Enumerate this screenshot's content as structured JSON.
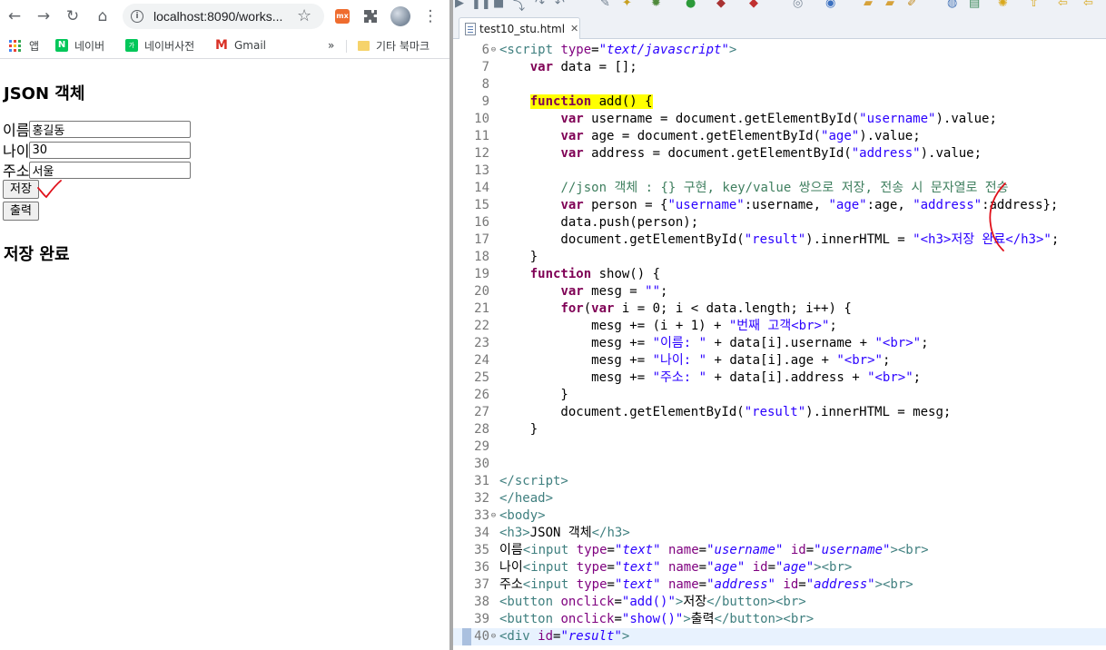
{
  "browser": {
    "url": "localhost:8090/works...",
    "bookmarks": [
      {
        "label": "앱",
        "icon": "apps-grid-icon"
      },
      {
        "label": "네이버",
        "icon": "naver-icon"
      },
      {
        "label": "네이버사전",
        "icon": "naver-dictionary-icon"
      },
      {
        "label": "Gmail",
        "icon": "gmail-icon"
      },
      {
        "label": "기타 북마크",
        "icon": "folder-icon"
      }
    ],
    "overflow_label": "»",
    "page": {
      "heading": "JSON 객체",
      "fields": [
        {
          "label": "이름",
          "value": "홍길동"
        },
        {
          "label": "나이",
          "value": "30"
        },
        {
          "label": "주소",
          "value": "서울"
        }
      ],
      "save_button": "저장",
      "show_button": "출력",
      "result": "저장 완료"
    }
  },
  "editor": {
    "tab_title": "test10_stu.html",
    "lines": [
      {
        "n": "6",
        "fold": true,
        "html": "<span class='tag'>&lt;script</span> <span class='attr'>type</span>=<span class='aval'>\"text/javascript\"</span><span class='tag'>&gt;</span>"
      },
      {
        "n": "7",
        "html": "    <span class='kw'>var</span> data = [];"
      },
      {
        "n": "8",
        "html": ""
      },
      {
        "n": "9",
        "html": "    <span class='hl'><span class='kw'>function</span> add() {</span>"
      },
      {
        "n": "10",
        "html": "        <span class='kw'>var</span> username = document.getElementById(<span class='str'>\"username\"</span>).value;"
      },
      {
        "n": "11",
        "html": "        <span class='kw'>var</span> age = document.getElementById(<span class='str'>\"age\"</span>).value;"
      },
      {
        "n": "12",
        "html": "        <span class='kw'>var</span> address = document.getElementById(<span class='str'>\"address\"</span>).value;"
      },
      {
        "n": "13",
        "html": ""
      },
      {
        "n": "14",
        "html": "        <span class='cmt'>//json 객체 : {} 구현, key/value 쌍으로 저장, 전송 시 문자열로 전송</span>"
      },
      {
        "n": "15",
        "html": "        <span class='kw'>var</span> person = {<span class='str'>\"username\"</span>:username, <span class='str'>\"age\"</span>:age, <span class='str'>\"address\"</span>:address};"
      },
      {
        "n": "16",
        "html": "        data.push(person);"
      },
      {
        "n": "17",
        "html": "        document.getElementById(<span class='str'>\"result\"</span>).innerHTML = <span class='str'>\"&lt;h3&gt;저장 완료&lt;/h3&gt;\"</span>;"
      },
      {
        "n": "18",
        "html": "    }"
      },
      {
        "n": "19",
        "html": "    <span class='kw'>function</span> show() {"
      },
      {
        "n": "20",
        "html": "        <span class='kw'>var</span> mesg = <span class='str'>\"\"</span>;"
      },
      {
        "n": "21",
        "html": "        <span class='kw'>for</span>(<span class='kw'>var</span> i = 0; i &lt; data.length; i++) {"
      },
      {
        "n": "22",
        "html": "            mesg += (i + 1) + <span class='str'>\"번째 고객&lt;br&gt;\"</span>;"
      },
      {
        "n": "23",
        "html": "            mesg += <span class='str'>\"이름: \"</span> + data[i].username + <span class='str'>\"&lt;br&gt;\"</span>;"
      },
      {
        "n": "24",
        "html": "            mesg += <span class='str'>\"나이: \"</span> + data[i].age + <span class='str'>\"&lt;br&gt;\"</span>;"
      },
      {
        "n": "25",
        "html": "            mesg += <span class='str'>\"주소: \"</span> + data[i].address + <span class='str'>\"&lt;br&gt;\"</span>;"
      },
      {
        "n": "26",
        "html": "        }"
      },
      {
        "n": "27",
        "html": "        document.getElementById(<span class='str'>\"result\"</span>).innerHTML = mesg;"
      },
      {
        "n": "28",
        "html": "    }"
      },
      {
        "n": "29",
        "html": ""
      },
      {
        "n": "30",
        "html": ""
      },
      {
        "n": "31",
        "html": "<span class='tag'>&lt;/script&gt;</span>"
      },
      {
        "n": "32",
        "html": "<span class='tag'>&lt;/head&gt;</span>"
      },
      {
        "n": "33",
        "fold": true,
        "html": "<span class='tag'>&lt;body&gt;</span>"
      },
      {
        "n": "34",
        "html": "<span class='tag'>&lt;h3&gt;</span>JSON 객체<span class='tag'>&lt;/h3&gt;</span>"
      },
      {
        "n": "35",
        "html": "이름<span class='tag'>&lt;input</span> <span class='attr'>type</span>=<span class='aval'>\"text\"</span> <span class='attr'>name</span>=<span class='aval'>\"username\"</span> <span class='attr'>id</span>=<span class='aval'>\"username\"</span><span class='tag'>&gt;&lt;br&gt;</span>"
      },
      {
        "n": "36",
        "html": "나이<span class='tag'>&lt;input</span> <span class='attr'>type</span>=<span class='aval'>\"text\"</span> <span class='attr'>name</span>=<span class='aval'>\"age\"</span> <span class='attr'>id</span>=<span class='aval'>\"age\"</span><span class='tag'>&gt;&lt;br&gt;</span>"
      },
      {
        "n": "37",
        "html": "주소<span class='tag'>&lt;input</span> <span class='attr'>type</span>=<span class='aval'>\"text\"</span> <span class='attr'>name</span>=<span class='aval'>\"address\"</span> <span class='attr'>id</span>=<span class='aval'>\"address\"</span><span class='tag'>&gt;&lt;br&gt;</span>"
      },
      {
        "n": "38",
        "html": "<span class='tag'>&lt;button</span> <span class='attr'>onclick</span>=<span class='str'>\"add()\"</span><span class='tag'>&gt;</span>저장<span class='tag'>&lt;/button&gt;&lt;br&gt;</span>"
      },
      {
        "n": "39",
        "html": "<span class='tag'>&lt;button</span> <span class='attr'>onclick</span>=<span class='str'>\"show()\"</span><span class='tag'>&gt;</span>출력<span class='tag'>&lt;/button&gt;&lt;br&gt;</span>"
      },
      {
        "n": "40",
        "fold": true,
        "current": true,
        "html": "<span class='tag'>&lt;div</span> <span class='attr'>id</span>=<span class='aval'>\"result\"</span><span class='tag'>&gt;</span>"
      }
    ]
  }
}
